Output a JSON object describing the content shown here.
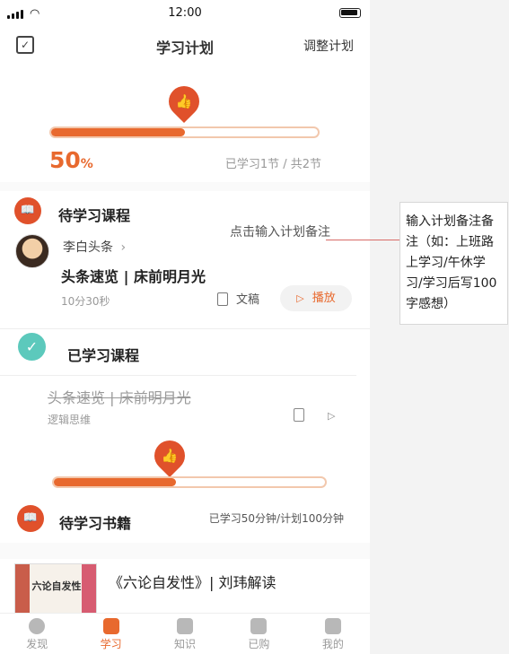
{
  "status_bar": {
    "time": "12:00"
  },
  "header": {
    "title": "学习计划",
    "right_action": "调整计划"
  },
  "top_progress": {
    "percent_value": "50",
    "percent_unit": "%",
    "summary": "已学习1节 / 共2节",
    "progress": 0.5
  },
  "pending_courses": {
    "title": "待学习课程",
    "note_hint": "点击输入计划备注",
    "author": "李白头条",
    "course_title": "头条速览 | 床前明月光",
    "duration": "10分30秒",
    "transcript_label": "文稿",
    "play_label": "播放"
  },
  "completed_courses": {
    "title": "已学习课程",
    "course_title": "头条速览 | 床前明月光",
    "category": "逻辑思维"
  },
  "books_progress": {
    "progress": 0.45
  },
  "pending_books": {
    "title": "待学习书籍",
    "summary": "已学习50分钟/计划100分钟",
    "book_title": "《六论自发性》| 刘玮解读",
    "cover_text": "六论自发性"
  },
  "bottom_nav": [
    {
      "label": "发现",
      "active": false
    },
    {
      "label": "学习",
      "active": true
    },
    {
      "label": "知识",
      "active": false
    },
    {
      "label": "已购",
      "active": false
    },
    {
      "label": "我的",
      "active": false
    }
  ],
  "annotation": {
    "text": "输入计划备注备注（如：上班路上学习/午休学习/学习后写100字感想）"
  },
  "colors": {
    "accent": "#e8692e",
    "pin": "#e0512b",
    "check": "#5cc9bc"
  }
}
